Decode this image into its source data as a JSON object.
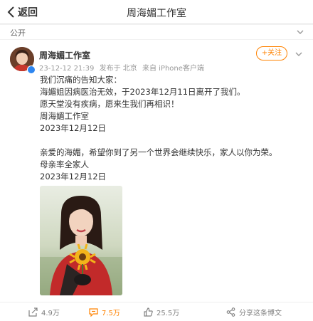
{
  "header": {
    "back_label": "返回",
    "title": "周海媚工作室"
  },
  "visibility": {
    "label": "公开"
  },
  "post": {
    "author": "周海媚工作室",
    "time": "23-12-12 21:39",
    "location": "发布于 北京",
    "source": "来自 iPhone客户端",
    "follow_label": "+关注",
    "lines": [
      "我们沉痛的告知大家：",
      "海媚姐因病医治无效，于2023年12月11日离开了我们。",
      "愿天堂没有疾病，愿来生我们再相识！",
      "周海媚工作室",
      "2023年12月12日",
      "亲爱的海媚，希望你到了另一个世界会继续快乐，家人以你为荣。",
      "母亲率全家人",
      "2023年12月12日"
    ]
  },
  "actions": {
    "share": "4.9万",
    "comment": "7.5万",
    "like": "25.5万",
    "share_weibo": "分享这条博文"
  },
  "colors": {
    "accent": "#ff8200",
    "verified": "#2e86f0"
  }
}
